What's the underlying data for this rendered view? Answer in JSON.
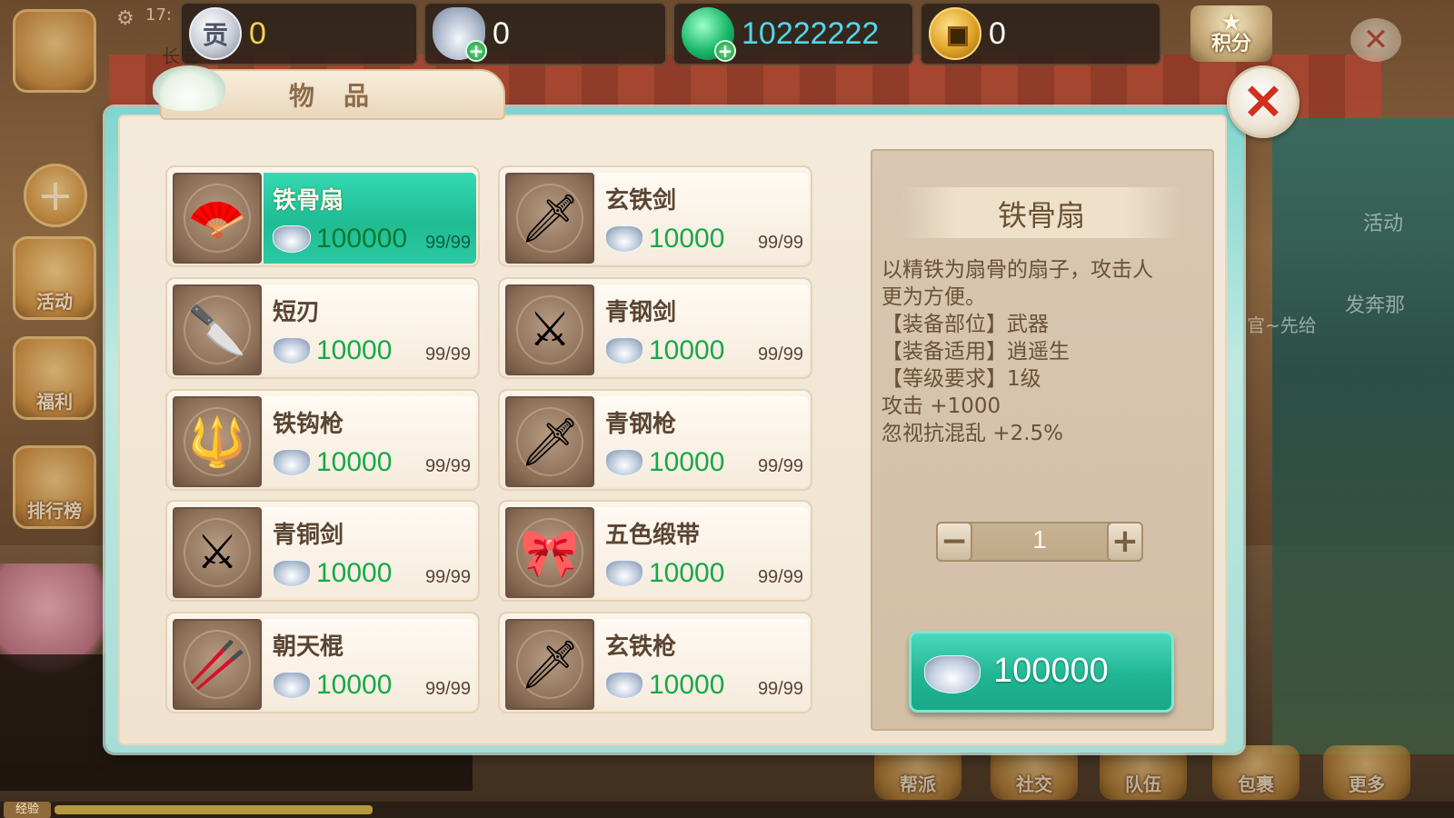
{
  "hud": {
    "time": "17:",
    "location": "长安",
    "currencies": [
      {
        "icon": "contribution-icon",
        "value": "0",
        "color": "#f2d54a"
      },
      {
        "icon": "silver-icon",
        "value": "0",
        "color": "#ffffff"
      },
      {
        "icon": "jade-icon",
        "value": "10222222",
        "color": "#4fd8ee"
      },
      {
        "icon": "copper-coin-icon",
        "value": "0",
        "color": "#ffffff"
      }
    ],
    "score_label": "积分"
  },
  "side_menu": {
    "activity": "活动",
    "welfare": "福利",
    "ranking": "排行榜"
  },
  "right_faded": {
    "activity": "活动",
    "text1": "发奔那",
    "text2": "官~先给"
  },
  "bottom_bar": {
    "exp_label": "经验",
    "buttons": [
      "帮派",
      "社交",
      "队伍",
      "包裹",
      "更多"
    ]
  },
  "dialog": {
    "tab_title": "物品",
    "close_symbol": "✕"
  },
  "items": [
    {
      "name": "铁骨扇",
      "price": "100000",
      "stock": "99/99",
      "icon": "iron-fan-icon",
      "glyph": "🪭",
      "selected": true
    },
    {
      "name": "玄铁剑",
      "price": "10000",
      "stock": "99/99",
      "icon": "black-iron-sword-icon",
      "glyph": "🗡"
    },
    {
      "name": "短刃",
      "price": "10000",
      "stock": "99/99",
      "icon": "short-blade-icon",
      "glyph": "🔪"
    },
    {
      "name": "青钢剑",
      "price": "10000",
      "stock": "99/99",
      "icon": "green-steel-sword-icon",
      "glyph": "⚔"
    },
    {
      "name": "铁钩枪",
      "price": "10000",
      "stock": "99/99",
      "icon": "iron-hook-spear-icon",
      "glyph": "🔱"
    },
    {
      "name": "青钢枪",
      "price": "10000",
      "stock": "99/99",
      "icon": "green-steel-spear-icon",
      "glyph": "🗡"
    },
    {
      "name": "青铜剑",
      "price": "10000",
      "stock": "99/99",
      "icon": "bronze-sword-icon",
      "glyph": "⚔"
    },
    {
      "name": "五色缎带",
      "price": "10000",
      "stock": "99/99",
      "icon": "five-color-ribbon-icon",
      "glyph": "🎀"
    },
    {
      "name": "朝天棍",
      "price": "10000",
      "stock": "99/99",
      "icon": "heavenward-staff-icon",
      "glyph": "🥢"
    },
    {
      "name": "玄铁枪",
      "price": "10000",
      "stock": "99/99",
      "icon": "black-iron-spear-icon",
      "glyph": "🗡"
    }
  ],
  "detail": {
    "title": "铁骨扇",
    "desc_lines": [
      "以精铁为扇骨的扇子，攻击人",
      "更为方便。",
      "【装备部位】武器",
      "【装备适用】逍遥生",
      "【等级要求】1级",
      "攻击   +1000",
      "忽视抗混乱   +2.5%"
    ],
    "quantity": "1",
    "minus": "−",
    "plus": "+",
    "buy_price": "100000"
  }
}
